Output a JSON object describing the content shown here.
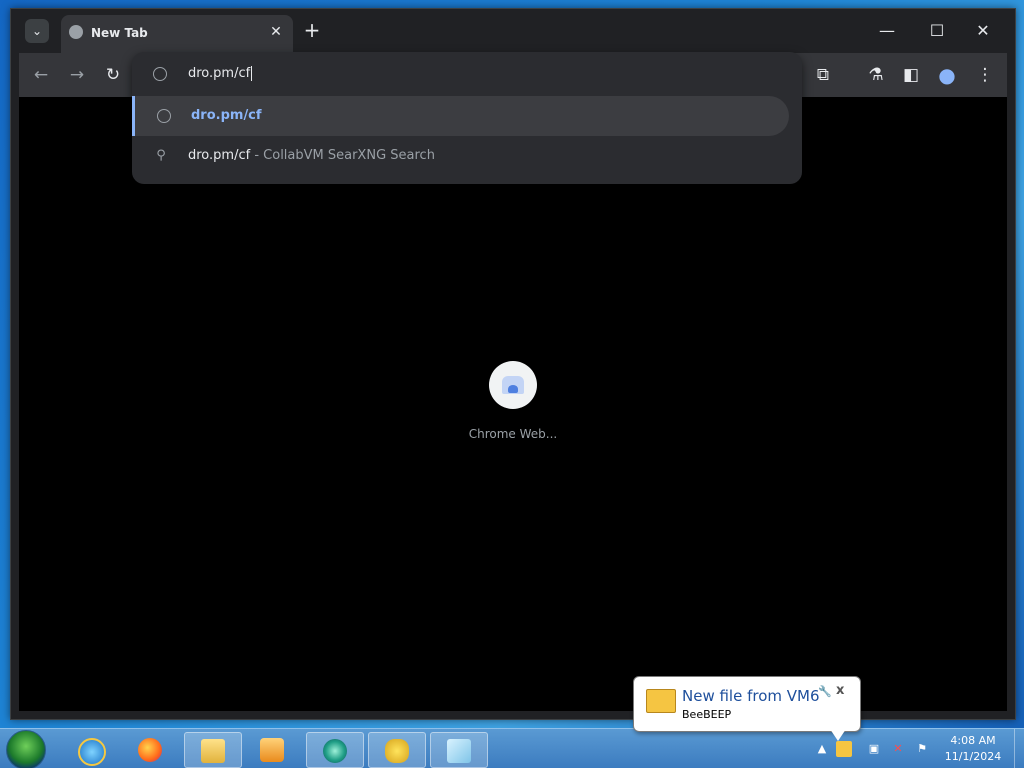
{
  "browser": {
    "tab": {
      "title": "New Tab"
    },
    "tab_search_icon": "chevron-down-icon",
    "new_tab_glyph": "+",
    "window_controls": {
      "minimize": "—",
      "maximize": "☐",
      "close": "✕"
    },
    "toolbar": {
      "back": "←",
      "forward": "→",
      "reload": "↻",
      "extensions": "⧉",
      "labs": "⚗",
      "sidepanel": "◧",
      "profile": "●",
      "menu": "⋮"
    },
    "omnibox": {
      "input_value": "dro.pm/cf",
      "suggestions": [
        {
          "url": "dro.pm/cf",
          "description": "",
          "icon": "globe-icon",
          "selected": true
        },
        {
          "url": "dro.pm/cf",
          "description": " - CollabVM SearXNG Search",
          "icon": "search-icon",
          "selected": false
        }
      ]
    },
    "content": {
      "shortcut_label": "Chrome Web..."
    }
  },
  "notification": {
    "title": "New file from VM6",
    "subtitle": "BeeBEEP"
  },
  "taskbar": {
    "apps": [
      "Internet Explorer",
      "Firefox",
      "Windows Explorer",
      "Media Player",
      "Chrome",
      "BeeBEEP",
      "Notepad"
    ],
    "clock_time": "4:08 AM",
    "clock_date": "11/1/2024"
  },
  "colors": {
    "accent": "#8ab4f8",
    "toolbar_bg": "#35363a",
    "omnibox_bg": "#2b2c30"
  }
}
